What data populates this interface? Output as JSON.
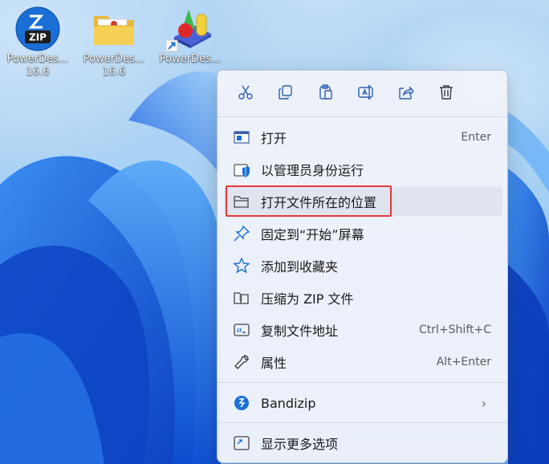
{
  "desktop": {
    "icons": [
      {
        "line1": "PowerDes...",
        "line2": "16.6",
        "type": "zip-archive"
      },
      {
        "line1": "PowerDes...",
        "line2": "16.6",
        "type": "folder"
      },
      {
        "line1": "PowerDes...",
        "line2": "",
        "type": "shortcut"
      }
    ]
  },
  "context_menu": {
    "toolbar": [
      {
        "icon": "cut-icon"
      },
      {
        "icon": "copy-icon"
      },
      {
        "icon": "paste-icon"
      },
      {
        "icon": "rename-icon"
      },
      {
        "icon": "share-icon"
      },
      {
        "icon": "delete-icon"
      }
    ],
    "items": [
      {
        "label": "打开",
        "shortcut": "Enter",
        "icon": "open-window-icon"
      },
      {
        "label": "以管理员身份运行",
        "shortcut": "",
        "icon": "admin-shield-icon"
      },
      {
        "label": "打开文件所在的位置",
        "shortcut": "",
        "icon": "folder-icon",
        "highlighted": true
      },
      {
        "label": "固定到“开始”屏幕",
        "shortcut": "",
        "icon": "pin-icon"
      },
      {
        "label": "添加到收藏夹",
        "shortcut": "",
        "icon": "star-icon"
      },
      {
        "label": "压缩为 ZIP 文件",
        "shortcut": "",
        "icon": "zip-folder-icon"
      },
      {
        "label": "复制文件地址",
        "shortcut": "Ctrl+Shift+C",
        "icon": "copy-path-icon"
      },
      {
        "label": "属性",
        "shortcut": "Alt+Enter",
        "icon": "wrench-icon"
      },
      {
        "label": "Bandizip",
        "shortcut": "",
        "icon": "bandizip-icon",
        "submenu": true
      },
      {
        "label": "显示更多选项",
        "shortcut": "",
        "icon": "more-options-icon"
      }
    ]
  },
  "colors": {
    "highlight_border": "#e33a3a",
    "accent": "#1a6fd6"
  }
}
